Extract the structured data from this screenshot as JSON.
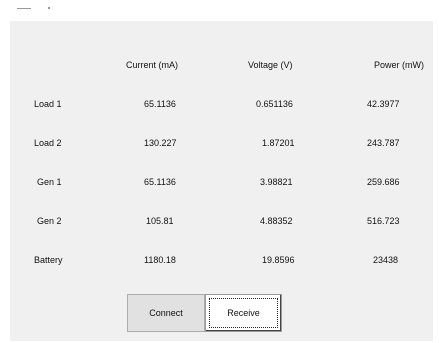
{
  "table": {
    "headers": {
      "current": "Current (mA)",
      "voltage": "Voltage (V)",
      "power": "Power (mW)"
    },
    "rows": [
      {
        "label": "Load 1",
        "current": "65.1136",
        "voltage": "0.651136",
        "power": "42.3977"
      },
      {
        "label": "Load 2",
        "current": "130.227",
        "voltage": "1.87201",
        "power": "243.787"
      },
      {
        "label": "Gen 1",
        "current": "65.1136",
        "voltage": "3.98821",
        "power": "259.686"
      },
      {
        "label": "Gen 2",
        "current": "105.81",
        "voltage": "4.88352",
        "power": "516.723"
      },
      {
        "label": "Battery",
        "current": "1180.18",
        "voltage": "19.8596",
        "power": "23438"
      }
    ]
  },
  "buttons": {
    "connect_label": "Connect",
    "receive_label": "Receive"
  },
  "colors": {
    "panel_background": "#f0f0f0",
    "button_face": "#e1e1e1"
  }
}
